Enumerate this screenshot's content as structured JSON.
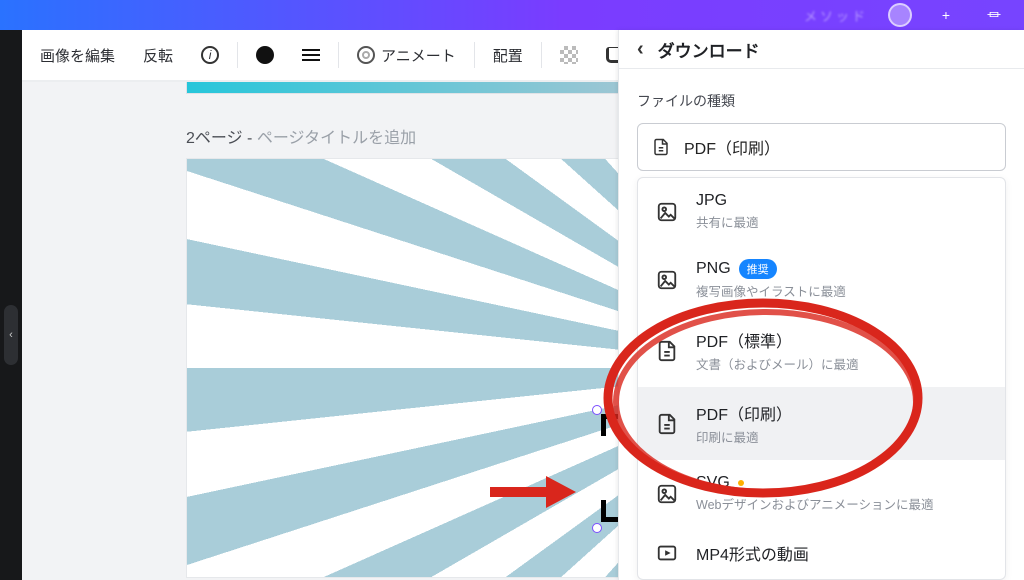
{
  "topbar": {
    "blurred_text": "メソッド",
    "plus": "+",
    "chart": "⏛"
  },
  "toolbar": {
    "edit_image": "画像を編集",
    "flip": "反転",
    "animate": "アニメート",
    "layout": "配置"
  },
  "page_label": {
    "prefix": "2ページ - ",
    "placeholder": "ページタイトルを追加"
  },
  "panel": {
    "title": "ダウンロード",
    "section": "ファイルの種類",
    "selected": "PDF（印刷）",
    "options": [
      {
        "name": "JPG",
        "desc": "共有に最適",
        "icon": "image"
      },
      {
        "name": "PNG",
        "desc": "複写画像やイラストに最適",
        "icon": "image",
        "badge": "推奨"
      },
      {
        "name": "PDF（標準）",
        "desc": "文書（およびメール）に最適",
        "icon": "file"
      },
      {
        "name": "PDF（印刷）",
        "desc": "印刷に最適",
        "icon": "file",
        "selected": true
      },
      {
        "name": "SVG",
        "desc": "Webデザインおよびアニメーションに最適",
        "icon": "image",
        "orig": true
      },
      {
        "name": "MP4形式の動画",
        "desc": "",
        "icon": "video"
      }
    ]
  }
}
